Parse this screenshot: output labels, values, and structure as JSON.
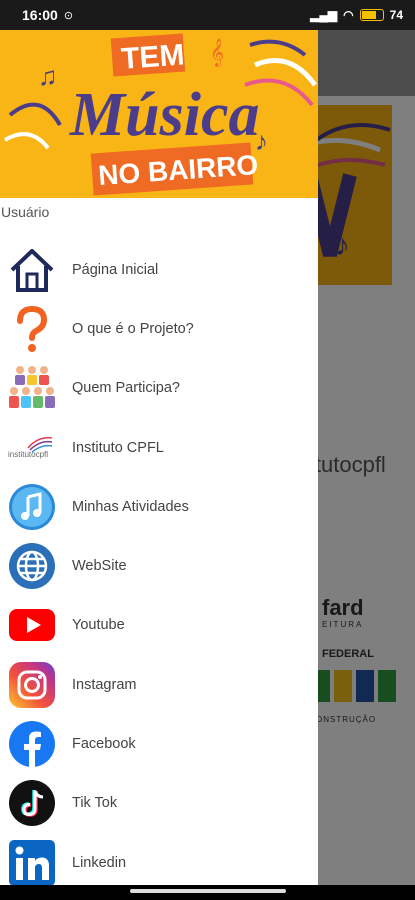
{
  "status_bar": {
    "time": "16:00",
    "battery_text": "74",
    "battery_level": 0.74
  },
  "banner": {
    "line1": "TEM",
    "line2": "Música",
    "line3": "NO BAIRRO"
  },
  "drawer": {
    "user_label": "Usuário",
    "items": [
      {
        "label": "Página Inicial",
        "icon": "home-icon"
      },
      {
        "label": "O que é o Projeto?",
        "icon": "question-icon"
      },
      {
        "label": "Quem Participa?",
        "icon": "people-icon"
      },
      {
        "label": "Instituto CPFL",
        "icon": "cpfl-logo-icon"
      },
      {
        "label": "Minhas Atividades",
        "icon": "music-note-icon"
      },
      {
        "label": "WebSite",
        "icon": "globe-icon"
      },
      {
        "label": "Youtube",
        "icon": "youtube-icon"
      },
      {
        "label": "Instagram",
        "icon": "instagram-icon"
      },
      {
        "label": "Facebook",
        "icon": "facebook-icon"
      },
      {
        "label": "Tik Tok",
        "icon": "tiktok-icon"
      },
      {
        "label": "Linkedin",
        "icon": "linkedin-icon"
      }
    ]
  },
  "background": {
    "cpfl_text": "itutocpfl",
    "sponsor1_text": "fard",
    "sponsor1_sub": "EITURA",
    "sponsor2_text": "FEDERAL",
    "sponsor2_sub": "ONSTRUÇÃO"
  },
  "colors": {
    "banner_yellow": "#f9b515",
    "banner_purple": "#4b3c8c",
    "banner_orange": "#ef6a22"
  }
}
